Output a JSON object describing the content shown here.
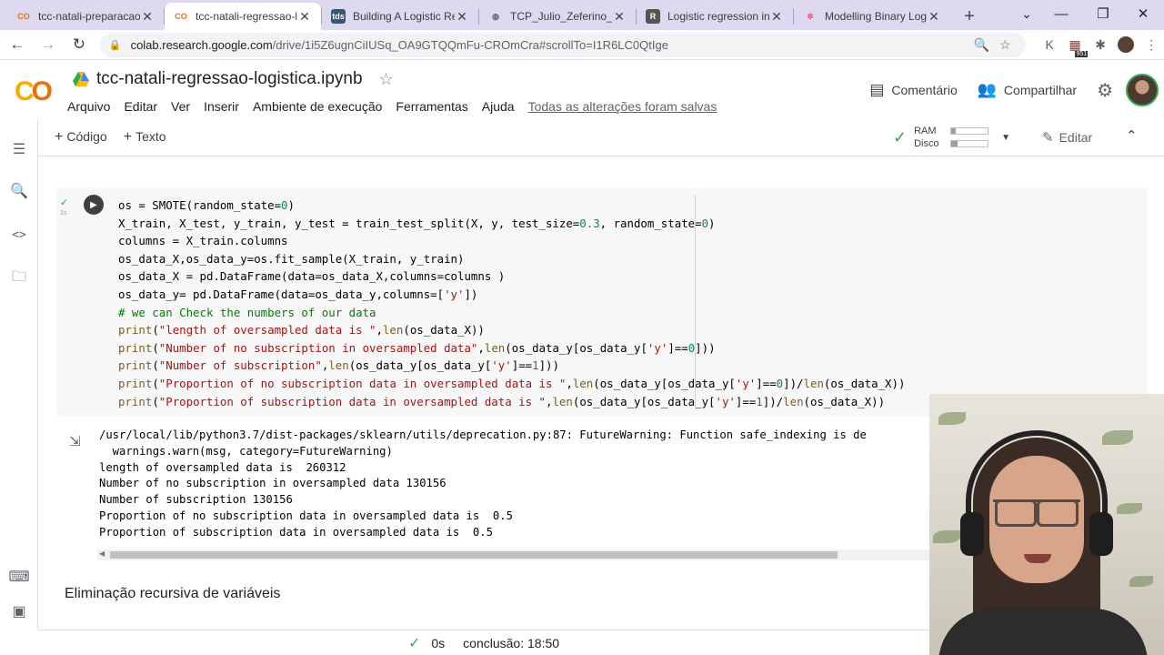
{
  "browser": {
    "tabs": [
      {
        "label": "tcc-natali-preparacao-",
        "favicon": "colab",
        "active": false
      },
      {
        "label": "tcc-natali-regressao-lo",
        "favicon": "colab",
        "active": true
      },
      {
        "label": "Building A Logistic Re",
        "favicon": "tds",
        "active": false
      },
      {
        "label": "TCP_Julio_Zeferino_Co",
        "favicon": "globe",
        "active": false
      },
      {
        "label": "Logistic regression in P",
        "favicon": "r",
        "active": false
      },
      {
        "label": "Modelling Binary Logis",
        "favicon": "grid",
        "active": false
      }
    ],
    "favicon_tds": "tds",
    "url_host": "colab.research.google.com",
    "url_path": "/drive/1i5Z6ugnCiIUSq_OA9GTQQmFu-CROmCra#scrollTo=I1R6LC0QtIge",
    "extension_badge": "951"
  },
  "colab": {
    "notebook_title": "tcc-natali-regressao-logistica.ipynb",
    "menu": [
      "Arquivo",
      "Editar",
      "Ver",
      "Inserir",
      "Ambiente de execução",
      "Ferramentas",
      "Ajuda"
    ],
    "saved_status": "Todas as alterações foram salvas",
    "comment_label": "Comentário",
    "share_label": "Compartilhar",
    "add_code_label": "Código",
    "add_text_label": "Texto",
    "ram_label": "RAM",
    "disk_label": "Disco",
    "ram_usage": 0.12,
    "disk_usage": 0.18,
    "edit_label": "Editar"
  },
  "cell": {
    "code_lines": [
      "os = SMOTE(random_state=0)",
      "X_train, X_test, y_train, y_test = train_test_split(X, y, test_size=0.3, random_state=0)",
      "columns = X_train.columns",
      "os_data_X,os_data_y=os.fit_sample(X_train, y_train)",
      "os_data_X = pd.DataFrame(data=os_data_X,columns=columns )",
      "os_data_y= pd.DataFrame(data=os_data_y,columns=['y'])",
      "# we can Check the numbers of our data",
      "print(\"length of oversampled data is \",len(os_data_X))",
      "print(\"Number of no subscription in oversampled data\",len(os_data_y[os_data_y['y']==0]))",
      "print(\"Number of subscription\",len(os_data_y[os_data_y['y']==1]))",
      "print(\"Proportion of no subscription data in oversampled data is \",len(os_data_y[os_data_y['y']==0])/len(os_data_X))",
      "print(\"Proportion of subscription data in oversampled data is \",len(os_data_y[os_data_y['y']==1])/len(os_data_X))"
    ],
    "output_lines": [
      "/usr/local/lib/python3.7/dist-packages/sklearn/utils/deprecation.py:87: FutureWarning: Function safe_indexing is de",
      "  warnings.warn(msg, category=FutureWarning)",
      "length of oversampled data is  260312",
      "Number of no subscription in oversampled data 130156",
      "Number of subscription 130156",
      "Proportion of no subscription data in oversampled data is  0.5",
      "Proportion of subscription data in oversampled data is  0.5"
    ]
  },
  "text_cell": "Eliminação recursiva de variáveis",
  "status": {
    "time": "0s",
    "completion": "conclusão: 18:50"
  },
  "colors": {
    "accent_orange": "#f9ab00",
    "check_green": "#34a853",
    "tab_strip": "#ded9f0"
  }
}
